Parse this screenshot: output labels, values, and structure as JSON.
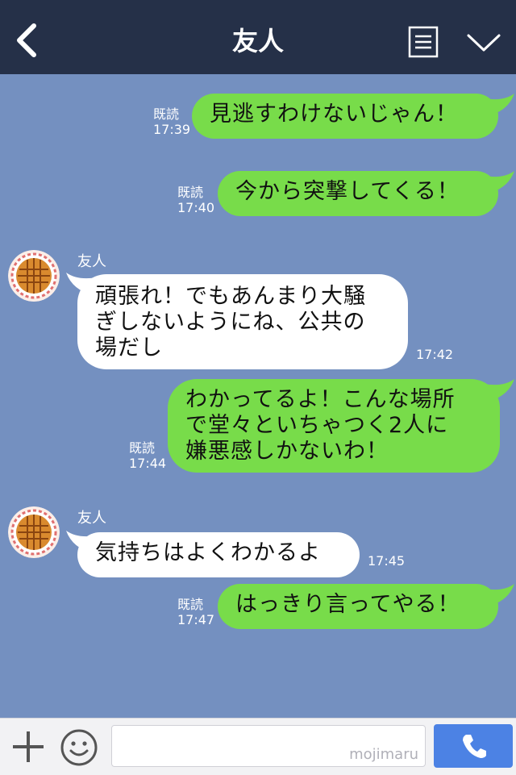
{
  "header": {
    "title": "友人",
    "back_icon": "chevron-left-icon",
    "menu_icon": "list-icon",
    "collapse_icon": "chevron-down-icon"
  },
  "messages": [
    {
      "type": "sent",
      "read": "既読",
      "time": "17:39",
      "text": "見逃すわけないじゃん！"
    },
    {
      "type": "sent",
      "read": "既読",
      "time": "17:40",
      "text": "今から突撃してくる！"
    },
    {
      "type": "recv",
      "sender": "友人",
      "time": "17:42",
      "text": "頑張れ！でもあんまり大騒\nぎしないようにね、公共の\n場だし"
    },
    {
      "type": "sent",
      "read": "既読",
      "time": "17:44",
      "text": "わかってるよ！こんな場所\nで堂々といちゃつく2人に\n嫌悪感しかないわ！"
    },
    {
      "type": "recv",
      "sender": "友人",
      "time": "17:45",
      "text": "気持ちはよくわかるよ"
    },
    {
      "type": "sent",
      "read": "既読",
      "time": "17:47",
      "text": "はっきり言ってやる！"
    }
  ],
  "footer": {
    "plus_icon": "plus-icon",
    "emoji_icon": "smile-icon",
    "input_value": "",
    "watermark": "mojimaru",
    "call_icon": "phone-icon"
  },
  "colors": {
    "header_bg": "#253048",
    "chat_bg": "#7490c0",
    "sent_bubble": "#78dc4a",
    "recv_bubble": "#ffffff",
    "call_button": "#4c82e4"
  }
}
